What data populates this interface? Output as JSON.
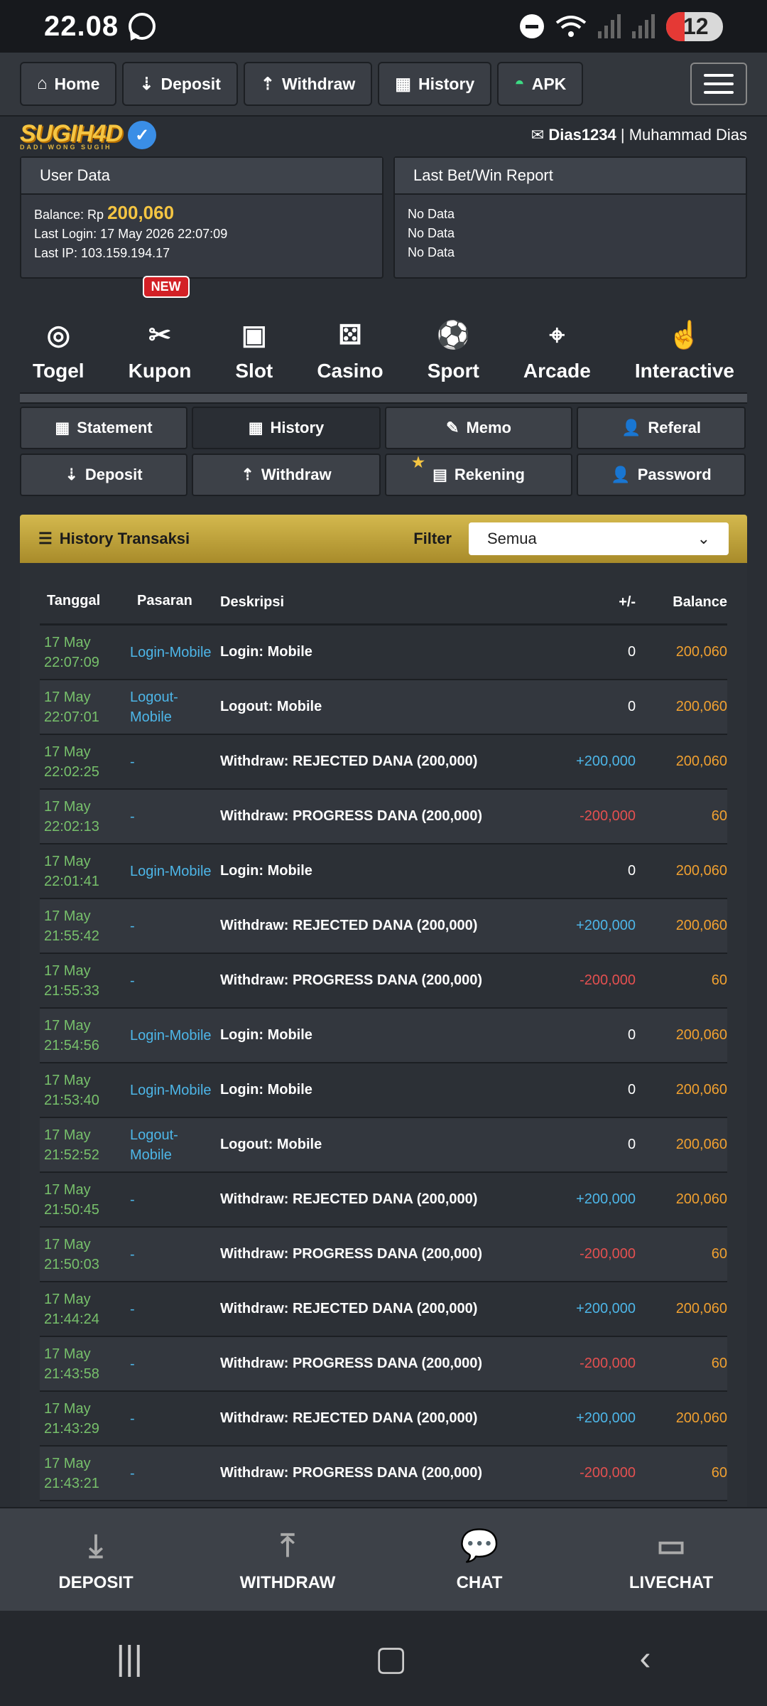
{
  "status": {
    "time": "22.08",
    "battery": "12"
  },
  "nav": {
    "home": "Home",
    "deposit": "Deposit",
    "withdraw": "Withdraw",
    "history": "History",
    "apk": "APK"
  },
  "brand": {
    "logo": "SUGIH4D",
    "tagline": "DADI WONG SUGIH"
  },
  "user": {
    "username": "Dias1234",
    "separator": " | ",
    "fullname": "Muhammad Dias"
  },
  "userdata": {
    "title": "User Data",
    "balance_label": "Balance: Rp ",
    "balance": "200,060",
    "last_login": "Last Login: 17 May 2026 22:07:09",
    "last_ip": "Last IP: 103.159.194.17"
  },
  "report": {
    "title": "Last Bet/Win Report",
    "lines": [
      "No Data",
      "No Data",
      "No Data"
    ]
  },
  "games": {
    "new_badge": "NEW",
    "items": [
      "Togel",
      "Kupon",
      "Slot",
      "Casino",
      "Sport",
      "Arcade",
      "Interactive"
    ]
  },
  "subnav": {
    "statement": "Statement",
    "history": "History",
    "memo": "Memo",
    "referal": "Referal",
    "deposit": "Deposit",
    "withdraw": "Withdraw",
    "rekening": "Rekening",
    "password": "Password"
  },
  "history": {
    "title": "History Transaksi",
    "filter_label": "Filter",
    "filter_value": "Semua"
  },
  "table": {
    "headers": [
      "Tanggal",
      "Pasaran",
      "Deskripsi",
      "+/-",
      "Balance"
    ],
    "rows": [
      {
        "d": "17 May",
        "t": "22:07:09",
        "p1": "Login-Mobile",
        "p2": "",
        "desc": "Login: Mobile",
        "amt": "0",
        "bal": "200,060"
      },
      {
        "d": "17 May",
        "t": "22:07:01",
        "p1": "Logout-",
        "p2": "Mobile",
        "desc": "Logout: Mobile",
        "amt": "0",
        "bal": "200,060"
      },
      {
        "d": "17 May",
        "t": "22:02:25",
        "p1": "-",
        "p2": "",
        "desc": "Withdraw: REJECTED DANA (200,000)",
        "amt": "+200,000",
        "bal": "200,060"
      },
      {
        "d": "17 May",
        "t": "22:02:13",
        "p1": "-",
        "p2": "",
        "desc": "Withdraw: PROGRESS DANA (200,000)",
        "amt": "-200,000",
        "bal": "60"
      },
      {
        "d": "17 May",
        "t": "22:01:41",
        "p1": "Login-Mobile",
        "p2": "",
        "desc": "Login: Mobile",
        "amt": "0",
        "bal": "200,060"
      },
      {
        "d": "17 May",
        "t": "21:55:42",
        "p1": "-",
        "p2": "",
        "desc": "Withdraw: REJECTED DANA (200,000)",
        "amt": "+200,000",
        "bal": "200,060"
      },
      {
        "d": "17 May",
        "t": "21:55:33",
        "p1": "-",
        "p2": "",
        "desc": "Withdraw: PROGRESS DANA (200,000)",
        "amt": "-200,000",
        "bal": "60"
      },
      {
        "d": "17 May",
        "t": "21:54:56",
        "p1": "Login-Mobile",
        "p2": "",
        "desc": "Login: Mobile",
        "amt": "0",
        "bal": "200,060"
      },
      {
        "d": "17 May",
        "t": "21:53:40",
        "p1": "Login-Mobile",
        "p2": "",
        "desc": "Login: Mobile",
        "amt": "0",
        "bal": "200,060"
      },
      {
        "d": "17 May",
        "t": "21:52:52",
        "p1": "Logout-",
        "p2": "Mobile",
        "desc": "Logout: Mobile",
        "amt": "0",
        "bal": "200,060"
      },
      {
        "d": "17 May",
        "t": "21:50:45",
        "p1": "-",
        "p2": "",
        "desc": "Withdraw: REJECTED DANA (200,000)",
        "amt": "+200,000",
        "bal": "200,060"
      },
      {
        "d": "17 May",
        "t": "21:50:03",
        "p1": "-",
        "p2": "",
        "desc": "Withdraw: PROGRESS DANA (200,000)",
        "amt": "-200,000",
        "bal": "60"
      },
      {
        "d": "17 May",
        "t": "21:44:24",
        "p1": "-",
        "p2": "",
        "desc": "Withdraw: REJECTED DANA (200,000)",
        "amt": "+200,000",
        "bal": "200,060"
      },
      {
        "d": "17 May",
        "t": "21:43:58",
        "p1": "-",
        "p2": "",
        "desc": "Withdraw: PROGRESS DANA (200,000)",
        "amt": "-200,000",
        "bal": "60"
      },
      {
        "d": "17 May",
        "t": "21:43:29",
        "p1": "-",
        "p2": "",
        "desc": "Withdraw: REJECTED DANA (200,000)",
        "amt": "+200,000",
        "bal": "200,060"
      },
      {
        "d": "17 May",
        "t": "21:43:21",
        "p1": "-",
        "p2": "",
        "desc": "Withdraw: PROGRESS DANA (200,000)",
        "amt": "-200,000",
        "bal": "60"
      }
    ]
  },
  "bottombar": {
    "deposit": "DEPOSIT",
    "withdraw": "WITHDRAW",
    "chat": "CHAT",
    "livechat": "LIVECHAT"
  },
  "colors": {
    "gold": "#f5c542",
    "date_green": "#77c06b",
    "link_blue": "#4db6e8",
    "negative_red": "#e45050",
    "balance_orange": "#f0a030"
  }
}
